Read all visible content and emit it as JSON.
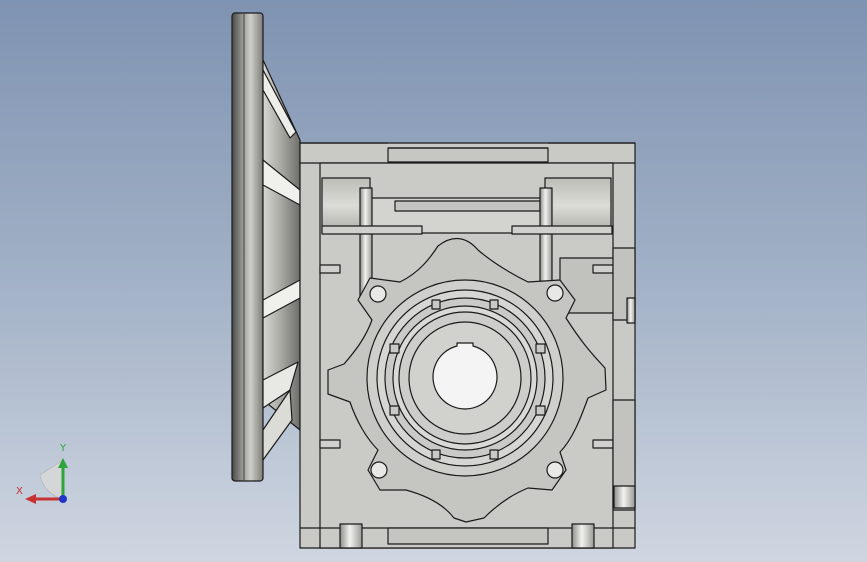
{
  "viewport": {
    "background_top": "#7f93b2",
    "background_bottom": "#cfd6e1",
    "model": "worm-gear-reducer-with-motor-flange"
  },
  "triad": {
    "x_label": "X",
    "y_label": "Y",
    "x_color": "#c83232",
    "y_color": "#2ea43a",
    "z_color": "#1f35c8"
  },
  "colors": {
    "housing": "#c9cac5",
    "housing_dark": "#b3b4af",
    "edge": "#1a1a1a",
    "bore": "#f4f4f4"
  }
}
